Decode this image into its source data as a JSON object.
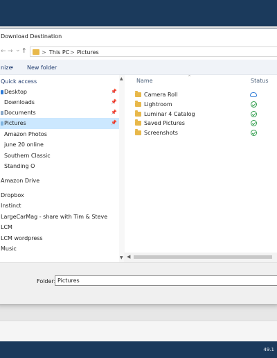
{
  "dialog": {
    "title": "Download Destination"
  },
  "address": {
    "segments": [
      "This PC",
      "Pictures"
    ],
    "separator": ">"
  },
  "nav_arrows": {
    "back": "←",
    "forward": "→",
    "dropdown": "⌄",
    "up": "↑"
  },
  "commands": {
    "organize": "nize",
    "organize_caret": "▾",
    "new_folder": "New folder"
  },
  "nav_pane": {
    "items": [
      {
        "label": "Quick access"
      },
      {
        "label": "Desktop",
        "pinned": true
      },
      {
        "label": "Downloads",
        "pinned": true
      },
      {
        "label": "Documents",
        "pinned": true
      },
      {
        "label": "Pictures",
        "pinned": true,
        "selected": true
      },
      {
        "label": "Amazon Photos"
      },
      {
        "label": "june 20 online"
      },
      {
        "label": "Southern Classic"
      },
      {
        "label": "Standing O"
      },
      {
        "label": "Amazon Drive"
      },
      {
        "label": "Dropbox"
      },
      {
        "label": "Instinct"
      },
      {
        "label": "LargeCarMag - share with Tim & Steve"
      },
      {
        "label": "LCM"
      },
      {
        "label": "LCM wordpress"
      },
      {
        "label": "Music"
      }
    ],
    "pin_glyph": "📌"
  },
  "file_list": {
    "columns": [
      "Name",
      "Status"
    ],
    "rows": [
      {
        "name": "Camera Roll",
        "status": "cloud"
      },
      {
        "name": "Lightroom",
        "status": "synced"
      },
      {
        "name": "Luminar 4 Catalog",
        "status": "synced"
      },
      {
        "name": "Saved Pictures",
        "status": "synced"
      },
      {
        "name": "Screenshots",
        "status": "synced"
      }
    ]
  },
  "folder_field": {
    "label": "Folder:",
    "value": "Pictures"
  },
  "taskbar": {
    "text": "49.1"
  },
  "colors": {
    "accent_dark": "#1b3a5c",
    "selection": "#cce8ff",
    "folder": "#e8b84a",
    "synced": "#2e9c4a",
    "cloud": "#2d7ad6"
  }
}
